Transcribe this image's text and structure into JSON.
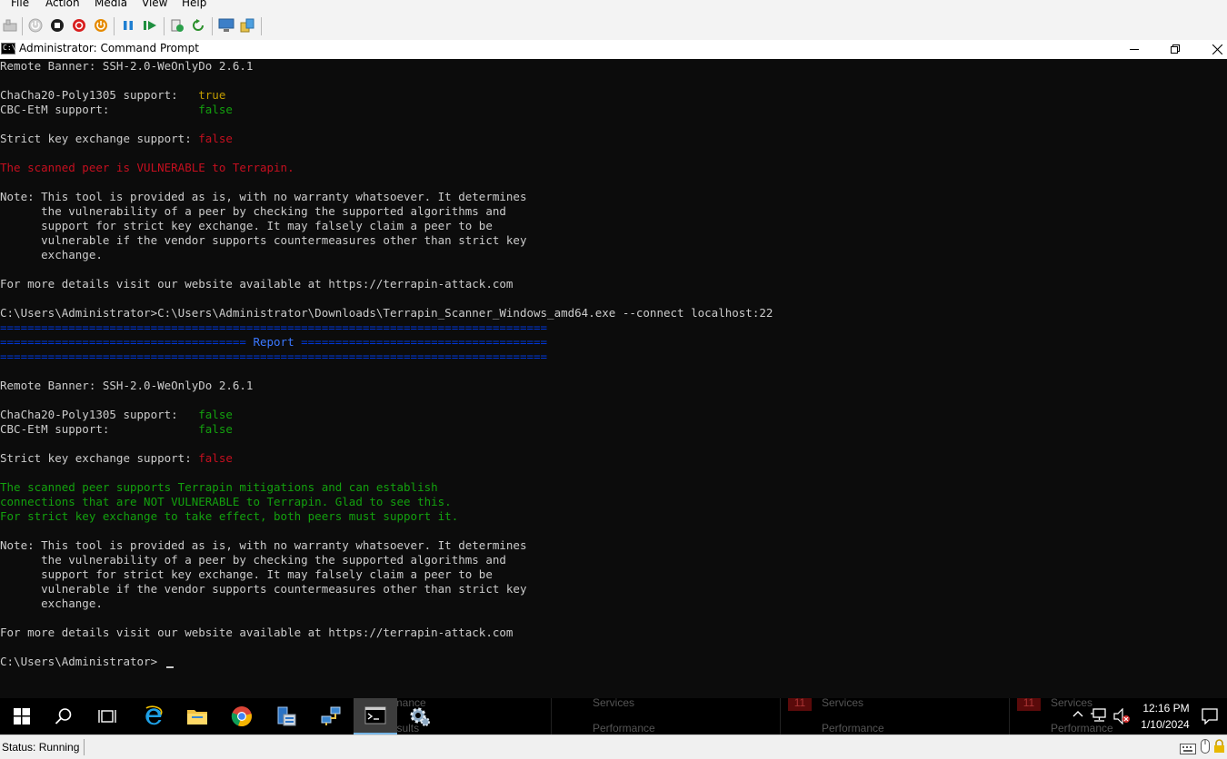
{
  "menu": [
    "File",
    "Action",
    "Media",
    "View",
    "Help"
  ],
  "toolbar": {
    "icons": [
      "ctrl-alt-del-icon",
      "start-icon",
      "turn-off-icon",
      "shut-down-icon",
      "save-state-icon",
      "pause-icon",
      "resume-icon",
      "checkpoint-icon",
      "revert-icon",
      "enhanced-session-icon",
      "share-icon"
    ]
  },
  "window": {
    "title": "Administrator: Command Prompt",
    "icon": "cmd-icon",
    "controls": [
      "minimize-icon",
      "restore-icon",
      "close-icon"
    ]
  },
  "console": {
    "lines": [
      {
        "segments": [
          {
            "text": "Remote Banner: SSH-2.0-WeOnlyDo 2.6.1",
            "color": "default"
          }
        ]
      },
      {
        "segments": []
      },
      {
        "segments": [
          {
            "text": "ChaCha20-Poly1305 support:   ",
            "color": "default"
          },
          {
            "text": "true",
            "color": "yellow"
          }
        ]
      },
      {
        "segments": [
          {
            "text": "CBC-EtM support:             ",
            "color": "default"
          },
          {
            "text": "false",
            "color": "green"
          }
        ]
      },
      {
        "segments": []
      },
      {
        "segments": [
          {
            "text": "Strict key exchange support: ",
            "color": "default"
          },
          {
            "text": "false",
            "color": "red"
          }
        ]
      },
      {
        "segments": []
      },
      {
        "segments": [
          {
            "text": "The scanned peer is VULNERABLE to Terrapin.",
            "color": "red"
          }
        ]
      },
      {
        "segments": []
      },
      {
        "segments": [
          {
            "text": "Note: This tool is provided as is, with no warranty whatsoever. It determines",
            "color": "default"
          }
        ]
      },
      {
        "segments": [
          {
            "text": "      the vulnerability of a peer by checking the supported algorithms and",
            "color": "default"
          }
        ]
      },
      {
        "segments": [
          {
            "text": "      support for strict key exchange. It may falsely claim a peer to be",
            "color": "default"
          }
        ]
      },
      {
        "segments": [
          {
            "text": "      vulnerable if the vendor supports countermeasures other than strict key",
            "color": "default"
          }
        ]
      },
      {
        "segments": [
          {
            "text": "      exchange.",
            "color": "default"
          }
        ]
      },
      {
        "segments": []
      },
      {
        "segments": [
          {
            "text": "For more details visit our website available at https://terrapin-attack.com",
            "color": "default"
          }
        ]
      },
      {
        "segments": []
      },
      {
        "segments": [
          {
            "text": "C:\\Users\\Administrator>C:\\Users\\Administrator\\Downloads\\Terrapin_Scanner_Windows_amd64.exe --connect localhost:22",
            "color": "default"
          }
        ]
      },
      {
        "segments": [
          {
            "text": "================================================================================",
            "color": "blue"
          }
        ]
      },
      {
        "segments": [
          {
            "text": "==================================== ",
            "color": "blue"
          },
          {
            "text": "Report",
            "color": "lightblue"
          },
          {
            "text": " ====================================",
            "color": "blue"
          }
        ]
      },
      {
        "segments": [
          {
            "text": "================================================================================",
            "color": "blue"
          }
        ]
      },
      {
        "segments": []
      },
      {
        "segments": [
          {
            "text": "Remote Banner: SSH-2.0-WeOnlyDo 2.6.1",
            "color": "default"
          }
        ]
      },
      {
        "segments": []
      },
      {
        "segments": [
          {
            "text": "ChaCha20-Poly1305 support:   ",
            "color": "default"
          },
          {
            "text": "false",
            "color": "green"
          }
        ]
      },
      {
        "segments": [
          {
            "text": "CBC-EtM support:             ",
            "color": "default"
          },
          {
            "text": "false",
            "color": "green"
          }
        ]
      },
      {
        "segments": []
      },
      {
        "segments": [
          {
            "text": "Strict key exchange support: ",
            "color": "default"
          },
          {
            "text": "false",
            "color": "red"
          }
        ]
      },
      {
        "segments": []
      },
      {
        "segments": [
          {
            "text": "The scanned peer supports Terrapin mitigations and can establish",
            "color": "green"
          }
        ]
      },
      {
        "segments": [
          {
            "text": "connections that are NOT VULNERABLE to Terrapin. Glad to see this.",
            "color": "green"
          }
        ]
      },
      {
        "segments": [
          {
            "text": "For strict key exchange to take effect, both peers must support it.",
            "color": "green"
          }
        ]
      },
      {
        "segments": []
      },
      {
        "segments": [
          {
            "text": "Note: This tool is provided as is, with no warranty whatsoever. It determines",
            "color": "default"
          }
        ]
      },
      {
        "segments": [
          {
            "text": "      the vulnerability of a peer by checking the supported algorithms and",
            "color": "default"
          }
        ]
      },
      {
        "segments": [
          {
            "text": "      support for strict key exchange. It may falsely claim a peer to be",
            "color": "default"
          }
        ]
      },
      {
        "segments": [
          {
            "text": "      vulnerable if the vendor supports countermeasures other than strict key",
            "color": "default"
          }
        ]
      },
      {
        "segments": [
          {
            "text": "      exchange.",
            "color": "default"
          }
        ]
      },
      {
        "segments": []
      },
      {
        "segments": [
          {
            "text": "For more details visit our website available at https://terrapin-attack.com",
            "color": "default"
          }
        ]
      },
      {
        "segments": []
      },
      {
        "segments": [
          {
            "text": "C:\\Users\\Administrator>",
            "color": "default"
          }
        ]
      }
    ]
  },
  "taskbar": {
    "apps": [
      "windows-start-icon",
      "search-icon",
      "task-view-icon",
      "internet-explorer-icon",
      "file-explorer-icon",
      "chrome-icon",
      "server-manager-icon",
      "network-icon",
      "command-prompt-icon",
      "settings-icon"
    ],
    "background_text": [
      {
        "text": "Performance"
      },
      {
        "text": "BPA results"
      },
      {
        "text": "Services"
      },
      {
        "text": "Performance"
      },
      {
        "text": "11"
      },
      {
        "text": "Services"
      },
      {
        "text": "Performance"
      },
      {
        "text": "11"
      },
      {
        "text": "Services"
      },
      {
        "text": "Performance"
      }
    ],
    "time": "12:16 PM",
    "date": "1/10/2024"
  },
  "status": {
    "text": "Status: Running"
  }
}
